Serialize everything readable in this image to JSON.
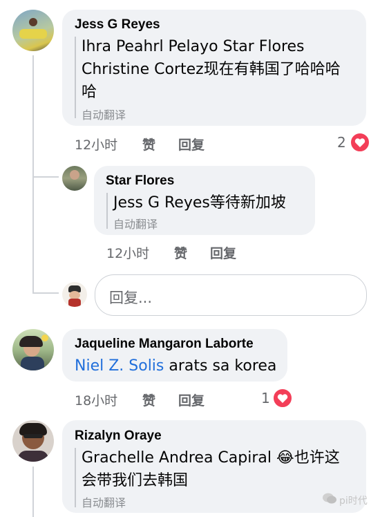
{
  "comments": [
    {
      "author": "Jess G Reyes",
      "text_line1": "Ihra Peahrl Pelayo Star Flores",
      "text_line2": "Christine Cortez现在有韩国了哈哈哈",
      "text_line3": "哈",
      "translate_label": "自动翻译",
      "time": "12小时",
      "like_label": "赞",
      "reply_label": "回复",
      "reaction_count": "2"
    },
    {
      "author": "Star Flores",
      "text": "Jess G Reyes等待新加坡",
      "translate_label": "自动翻译",
      "time": "12小时",
      "like_label": "赞",
      "reply_label": "回复"
    },
    {
      "author": "Jaqueline Mangaron Laborte",
      "mention": "Niel Z. Solis",
      "text_rest": " arats sa korea",
      "time": "18小时",
      "like_label": "赞",
      "reply_label": "回复",
      "reaction_count": "1"
    },
    {
      "author": "Rizalyn Oraye",
      "text_line1_a": "Grachelle Andrea Capiral ",
      "emoji": "😂",
      "text_line1_b": "也许这",
      "text_line2": "会带我们去韩国",
      "translate_label": "自动翻译"
    }
  ],
  "reply_box": {
    "placeholder": "回复..."
  },
  "watermark": "pi时代",
  "colors": {
    "heart": "#f33e58",
    "link": "#216fdb",
    "bubble": "#f0f2f5",
    "meta": "#65676b"
  }
}
